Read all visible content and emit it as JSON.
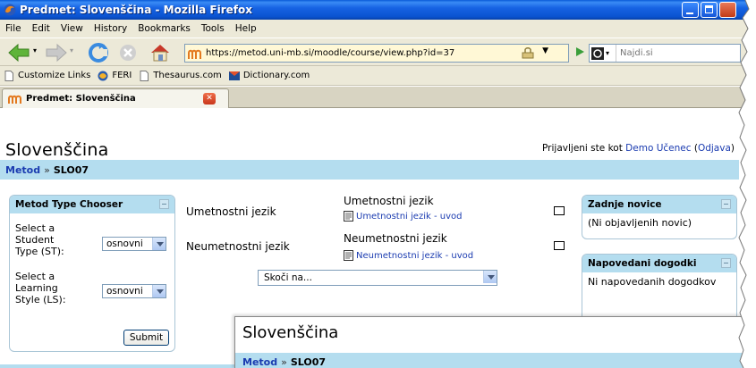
{
  "window": {
    "title": "Predmet: Slovenščina - Mozilla Firefox"
  },
  "menu": [
    "File",
    "Edit",
    "View",
    "History",
    "Bookmarks",
    "Tools",
    "Help"
  ],
  "nav": {
    "url": "https://metod.uni-mb.si/moodle/course/view.php?id=37",
    "search_placeholder": "Najdi.si"
  },
  "bookmarks": [
    {
      "label": "Customize Links",
      "icon": "page-icon"
    },
    {
      "label": "FERI",
      "icon": "feri-icon"
    },
    {
      "label": "Thesaurus.com",
      "icon": "page-icon"
    },
    {
      "label": "Dictionary.com",
      "icon": "dictionary-icon"
    }
  ],
  "tab": {
    "label": "Predmet: Slovenščina"
  },
  "page": {
    "course_title": "Slovenščina",
    "logged_in_prefix": "Prijavljeni ste kot",
    "user_name": "Demo Učenec",
    "logout_label": "Odjava",
    "breadcrumb": {
      "root": "Metod",
      "sep": "»",
      "current": "SLO07"
    }
  },
  "chooser": {
    "title": "Metod Type Chooser",
    "student_type_label": [
      "Select a",
      "Student",
      "Type (ST):"
    ],
    "student_type_value": "osnovni",
    "learning_style_label": [
      "Select a",
      "Learning",
      "Style (LS):"
    ],
    "learning_style_value": "osnovni",
    "submit_label": "Submit"
  },
  "content": {
    "sections": [
      {
        "name": "Umetnostni jezik",
        "heading": "Umetnostni jezik",
        "resource": "Umetnostni jezik - uvod"
      },
      {
        "name": "Neumetnostni jezik",
        "heading": "Neumetnostni jezik",
        "resource": "Neumetnostni jezik - uvod"
      }
    ],
    "jump_label": "Skoči na..."
  },
  "news": {
    "title": "Zadnje novice",
    "body": "(Ni objavljenih novic)"
  },
  "events": {
    "title": "Napovedani dogodki",
    "body": "Ni napovedanih dogodkov"
  },
  "overlay": {
    "course_title": "Slovenščina",
    "breadcrumb": {
      "root": "Metod",
      "sep": "»",
      "current": "SLO07"
    }
  }
}
